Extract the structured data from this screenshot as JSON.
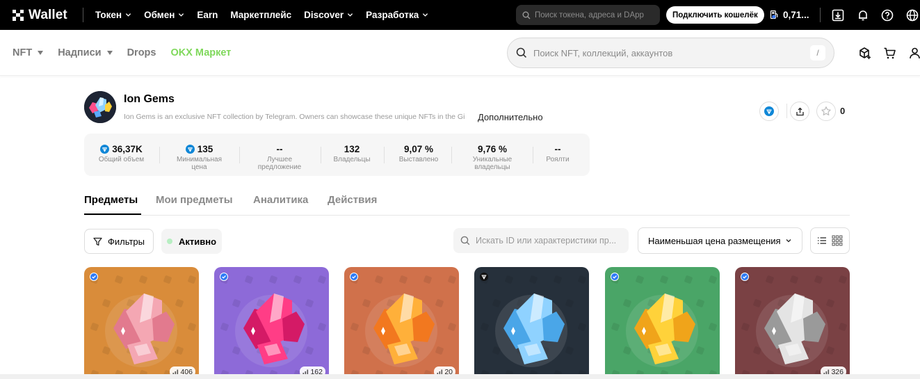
{
  "topbar": {
    "brand": "Wallet",
    "nav": [
      "Токен",
      "Обмен",
      "Earn",
      "Маркетплейс",
      "Discover",
      "Разработка"
    ],
    "search_placeholder": "Поиск токена, адреса и DApp",
    "connect_label": "Подключить кошелёк",
    "balance": "0,71..."
  },
  "subbar": {
    "nav": [
      {
        "label": "NFT",
        "dropdown": true
      },
      {
        "label": "Надписи",
        "dropdown": true
      },
      {
        "label": "Drops",
        "dropdown": false
      },
      {
        "label": "OKX Маркет",
        "dropdown": false
      }
    ],
    "search_placeholder": "Поиск NFT, коллекций, аккаунтов",
    "search_shortcut": "/"
  },
  "collection": {
    "name": "Ion Gems",
    "description": "Ion Gems is an exclusive NFT collection by Telegram. Owners can showcase these unique NFTs in the Gi",
    "more_label": "Дополнительно",
    "favorites_count": "0"
  },
  "stats": [
    {
      "value": "36,37K",
      "label": "Общий объем",
      "ton": true
    },
    {
      "value": "135",
      "label": "Минимальная цена",
      "ton": true
    },
    {
      "value": "--",
      "label": "Лучшее предложение",
      "ton": false
    },
    {
      "value": "132",
      "label": "Владельцы",
      "ton": false
    },
    {
      "value": "9,07 %",
      "label": "Выставлено",
      "ton": false
    },
    {
      "value": "9,76 %",
      "label": "Уникальные владельцы",
      "ton": false
    },
    {
      "value": "--",
      "label": "Роялти",
      "ton": false
    }
  ],
  "tabs": [
    "Предметы",
    "Мои предметы",
    "Аналитика",
    "Действия"
  ],
  "filters": {
    "filter_label": "Фильтры",
    "active_label": "Активно",
    "id_search_placeholder": "Искать ID или характеристики пр...",
    "sort_label": "Наименьшая цена размещения"
  },
  "cards": [
    {
      "bg": "#d98c3a",
      "gem": "#f4a7b3",
      "gem_dark": "#e27a8e",
      "rarity": "406",
      "badge": "verified"
    },
    {
      "bg": "#8d6ad8",
      "gem": "#ff3d86",
      "gem_dark": "#d41a66",
      "rarity": "162",
      "badge": "verified"
    },
    {
      "bg": "#d0714b",
      "gem": "#ffb03a",
      "gem_dark": "#f2781f",
      "rarity": "20",
      "badge": "verified"
    },
    {
      "bg": "#26303b",
      "gem": "#8fd2ff",
      "gem_dark": "#4aa6e8",
      "rarity": "",
      "badge": "ton"
    },
    {
      "bg": "#4aa567",
      "gem": "#ffd23a",
      "gem_dark": "#f0a41a",
      "rarity": "",
      "badge": "verified"
    },
    {
      "bg": "#7a4144",
      "gem": "#e4e4e4",
      "gem_dark": "#9a9a9a",
      "rarity": "326",
      "badge": "verified"
    }
  ],
  "colors": {
    "accent_green": "#7fd85b",
    "ton_blue": "#0f87d7",
    "verify_blue": "#2f7bf6"
  }
}
